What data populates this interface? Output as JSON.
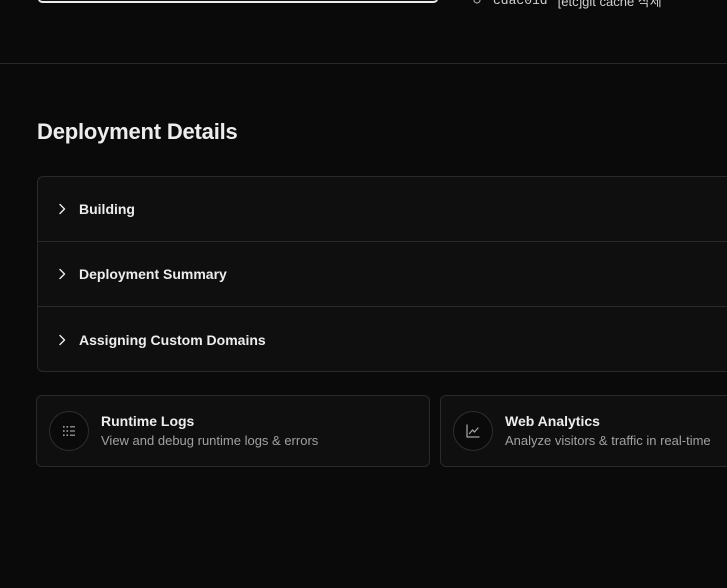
{
  "top": {
    "commit_sha": "cdac01d",
    "commit_message": "[etc]git cache 삭제"
  },
  "deployment_details": {
    "title": "Deployment Details",
    "items": [
      {
        "label": "Building"
      },
      {
        "label": "Deployment Summary"
      },
      {
        "label": "Assigning Custom Domains"
      }
    ]
  },
  "cards": [
    {
      "title": "Runtime Logs",
      "subtitle": "View and debug runtime logs & errors",
      "icon": "list-icon"
    },
    {
      "title": "Web Analytics",
      "subtitle": "Analyze visitors & traffic in real-time",
      "icon": "line-chart-icon"
    }
  ],
  "colors": {
    "background": "#0a0a0a",
    "border": "#2a2a2a",
    "text_primary": "#ededed",
    "text_secondary": "#a1a1a1"
  }
}
